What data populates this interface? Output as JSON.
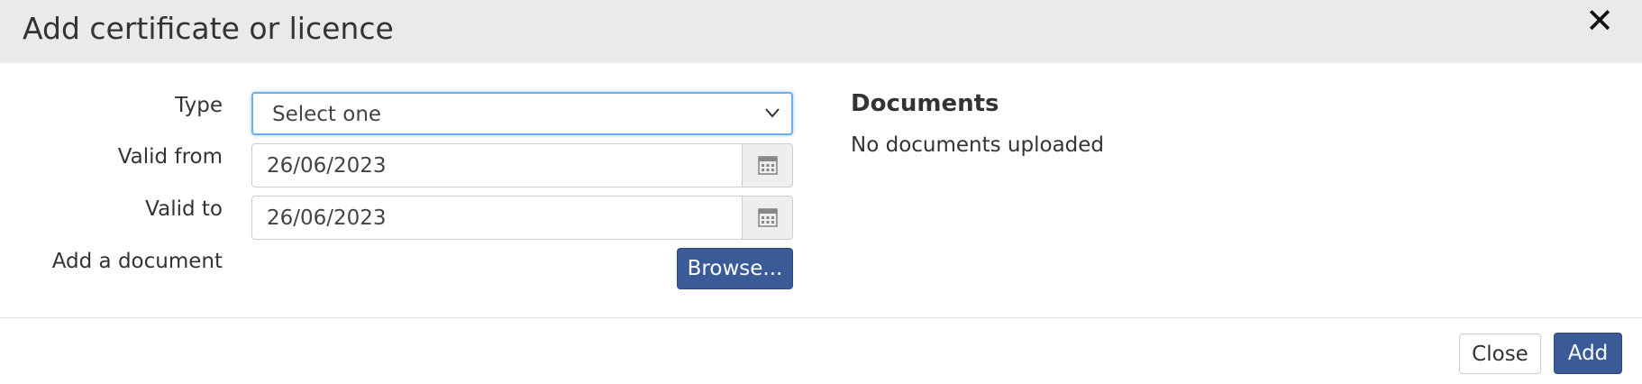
{
  "dialog": {
    "title": "Add certificate or licence",
    "close_icon": "close-icon"
  },
  "form": {
    "type": {
      "label": "Type",
      "selected": "Select one",
      "icon": "chevron-down-icon"
    },
    "valid_from": {
      "label": "Valid from",
      "value": "26/06/2023",
      "icon": "calendar-icon"
    },
    "valid_to": {
      "label": "Valid to",
      "value": "26/06/2023",
      "icon": "calendar-icon"
    },
    "document": {
      "label": "Add a document",
      "browse_label": "Browse..."
    }
  },
  "documents": {
    "heading": "Documents",
    "empty_text": "No documents uploaded"
  },
  "footer": {
    "close_label": "Close",
    "add_label": "Add"
  },
  "colors": {
    "header_bg": "#eaeaea",
    "primary": "#3a5a98",
    "focus_border": "#6faee6"
  }
}
